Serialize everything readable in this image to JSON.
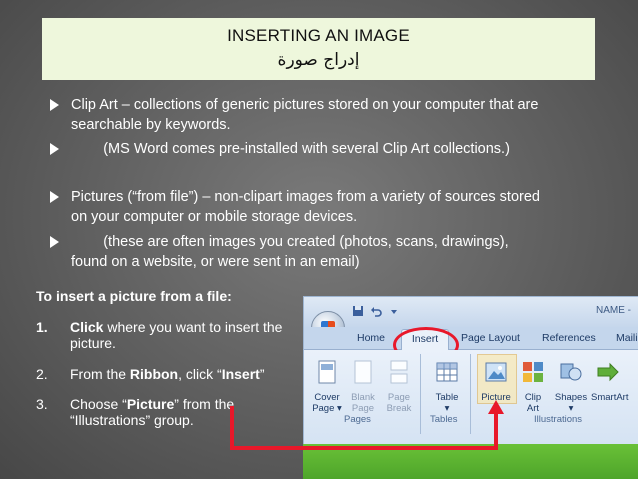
{
  "slide": {
    "title": "INSERTING AN IMAGE",
    "subtitle": "إدراج صورة"
  },
  "bullets": [
    {
      "line1": "Clip Art – collections of generic pictures stored on your computer that are",
      "line2": "searchable by keywords."
    },
    {
      "line1": "        (MS Word comes pre-installed with several Clip Art collections.)"
    },
    {
      "line1": "Pictures (“from file”) – non-clipart images from a variety of sources stored",
      "line2": "on your computer or mobile storage devices."
    },
    {
      "line1": "        (these are often images you created (photos, scans, drawings),",
      "line2": "found on a website, or were sent in an email)"
    }
  ],
  "steps": {
    "heading": "To insert a picture from a file:",
    "items": [
      {
        "num": "1.",
        "pre": "",
        "bold": "Click",
        "post": " where you want to insert the picture."
      },
      {
        "num": "2.",
        "pre": "From the ",
        "bold": "Ribbon",
        "post": ", click “",
        "bold2": "Insert",
        "post2": "”"
      },
      {
        "num": "3.",
        "pre": "Choose “",
        "bold": "Picture",
        "post": "” from the “Illustrations” group."
      }
    ]
  },
  "ribbon": {
    "name_label": "NAME -",
    "tabs": [
      "Home",
      "Insert",
      "Page Layout",
      "References",
      "Maili"
    ],
    "commands": [
      {
        "line1": "Cover",
        "line2": "Page ▾",
        "enabled": true
      },
      {
        "line1": "Blank",
        "line2": "Page",
        "enabled": false
      },
      {
        "line1": "Page",
        "line2": "Break",
        "enabled": false
      },
      {
        "line1": "Table",
        "line2": "▾",
        "enabled": true
      },
      {
        "line1": "Picture",
        "line2": "",
        "enabled": true
      },
      {
        "line1": "Clip",
        "line2": "Art",
        "enabled": true
      },
      {
        "line1": "Shapes",
        "line2": "▾",
        "enabled": true
      },
      {
        "line1": "SmartArt",
        "line2": "",
        "enabled": true
      }
    ],
    "groups": [
      "Pages",
      "Tables",
      "Illustrations"
    ]
  },
  "colors": {
    "title_bg": "#eef7dc",
    "highlight": "#e8182a",
    "accent_bar": "#5bb52f"
  }
}
